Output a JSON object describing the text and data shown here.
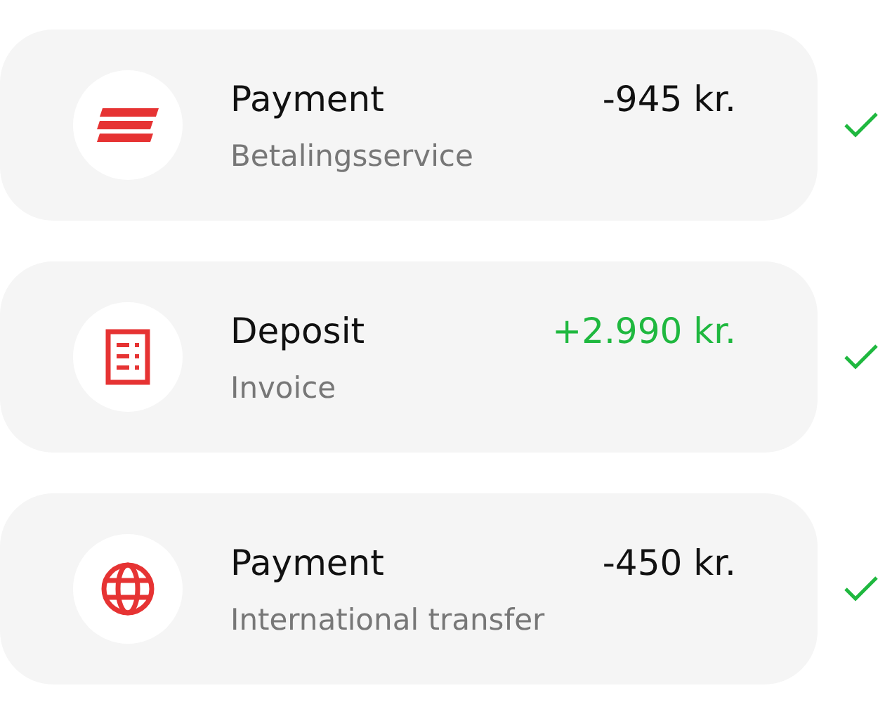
{
  "transactions": [
    {
      "kind": "debit",
      "title": "Payment",
      "subtitle": "Betalingsservice",
      "amount": "-945 kr.",
      "confirmed": true
    },
    {
      "kind": "deposit",
      "title": "Deposit",
      "subtitle": "Invoice",
      "amount": "+2.990 kr.",
      "confirmed": true
    },
    {
      "kind": "transfer",
      "title": "Payment",
      "subtitle": "International transfer",
      "amount": "-450 kr.",
      "confirmed": true
    }
  ]
}
